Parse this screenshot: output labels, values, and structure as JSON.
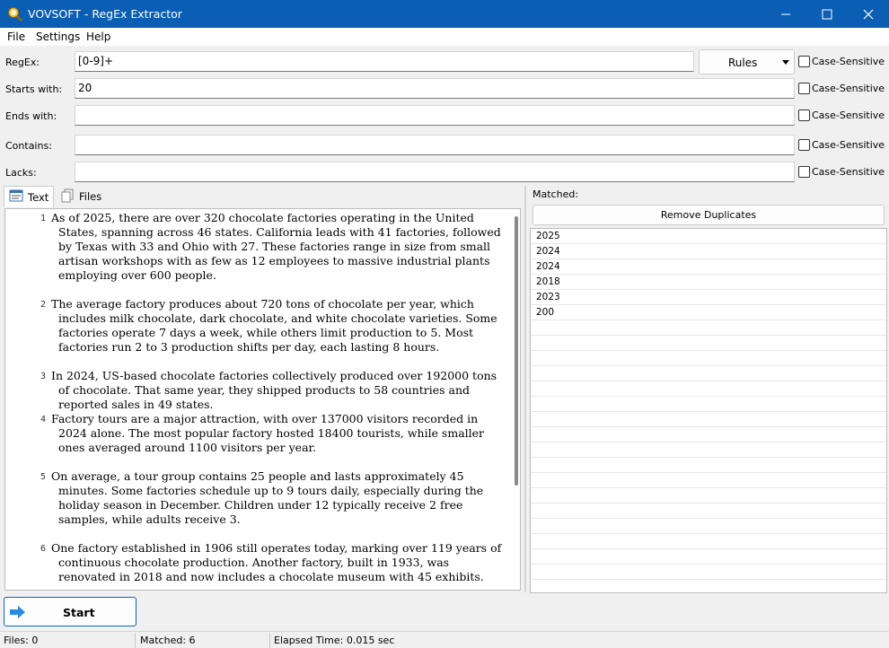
{
  "window": {
    "title": "VOVSOFT - RegEx Extractor"
  },
  "menu": [
    "File",
    "Settings",
    "Help"
  ],
  "fields": {
    "regex": {
      "label": "RegEx:",
      "value": "[0-9]+"
    },
    "starts_with": {
      "label": "Starts with:",
      "value": "20"
    },
    "ends_with": {
      "label": "Ends with:",
      "value": ""
    },
    "contains": {
      "label": "Contains:",
      "value": ""
    },
    "lacks": {
      "label": "Lacks:",
      "value": ""
    }
  },
  "rules_button": "Rules",
  "case_sensitive_label": "Case-Sensitive",
  "tabs": {
    "text": "Text",
    "files": "Files"
  },
  "editor": {
    "lines": [
      {
        "num": "1",
        "text": "As of 2025, there are over 320 chocolate factories operating in the United States, spanning across 46 states. California leads with 41 factories, followed by Texas with 33 and Ohio with 27. These factories range in size from small artisan workshops with as few as 12 employees to massive industrial plants employing over 600 people."
      },
      {
        "num": "2",
        "text": "The average factory produces about 720 tons of chocolate per year, which includes milk chocolate, dark chocolate, and white chocolate varieties. Some factories operate 7 days a week, while others limit production to 5. Most factories run 2 to 3 production shifts per day, each lasting 8 hours."
      },
      {
        "num": "3",
        "text": "In 2024, US-based chocolate factories collectively produced over 192000 tons of chocolate. That same year, they shipped products to 58 countries and reported sales in 49 states."
      },
      {
        "num": "4",
        "text": "Factory tours are a major attraction, with over 137000 visitors recorded in 2024 alone. The most popular factory hosted 18400 tourists, while smaller ones averaged around 1100 visitors per year."
      },
      {
        "num": "5",
        "text": "On average, a tour group contains 25 people and lasts approximately 45 minutes. Some factories schedule up to 9 tours daily, especially during the holiday season in December. Children under 12 typically receive 2 free samples, while adults receive 3."
      },
      {
        "num": "6",
        "text": "One factory established in 1906 still operates today, marking over 119 years of continuous chocolate production. Another factory, built in 1933, was renovated in 2018 and now includes a chocolate museum with 45 exhibits."
      }
    ]
  },
  "matched": {
    "label": "Matched:",
    "remove_duplicates": "Remove Duplicates",
    "items": [
      "2025",
      "2024",
      "2024",
      "2018",
      "2023",
      "200"
    ]
  },
  "start_button": "Start",
  "status": {
    "files": "Files: 0",
    "matched": "Matched: 6",
    "elapsed": "Elapsed Time: 0.015 sec"
  },
  "colors": {
    "titlebar": "#0a5fb4",
    "accent": "#0a64c8"
  }
}
